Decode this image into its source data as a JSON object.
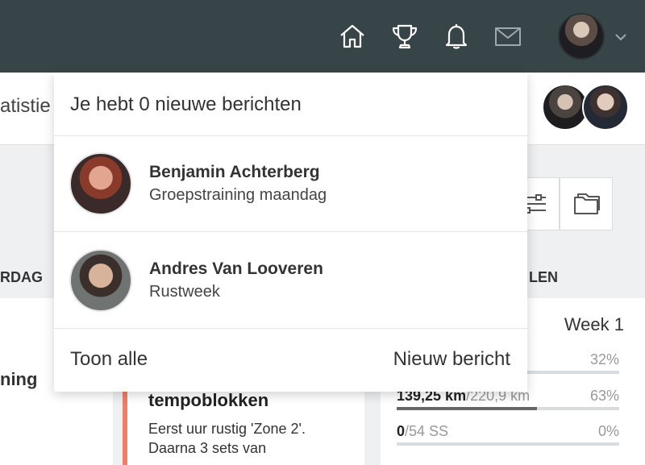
{
  "topbar": {
    "icons": [
      "home-icon",
      "trophy-icon",
      "bell-icon",
      "envelope-icon"
    ],
    "user_menu_icon": "chevron-down-icon"
  },
  "subbar": {
    "title_fragment": "atistie"
  },
  "columns": {
    "left_header": "RDAG",
    "right_header": "LEN"
  },
  "left_panel": {
    "label": "ning"
  },
  "workout": {
    "title": "tempoblokken",
    "description": "Eerst uur rustig 'Zone 2'. Daarna 3 sets van"
  },
  "week_panel": {
    "label": "Week 1",
    "stats": [
      {
        "value": "",
        "target": "",
        "pct": "32%",
        "fraction": 0.32
      },
      {
        "value": "139,25 km",
        "target": "/220,9 km",
        "pct": "63%",
        "fraction": 0.63
      },
      {
        "value": "0",
        "target": "/54 SS",
        "pct": "0%",
        "fraction": 0.0
      }
    ]
  },
  "messages": {
    "header": "Je hebt 0 nieuwe berichten",
    "items": [
      {
        "name": "Benjamin Achterberg",
        "subject": "Groepstraining maandag"
      },
      {
        "name": "Andres Van Looveren",
        "subject": "Rustweek"
      }
    ],
    "show_all": "Toon alle",
    "new_message": "Nieuw bericht"
  },
  "colors": {
    "topbar": "#374549",
    "accent": "#e8806a"
  }
}
